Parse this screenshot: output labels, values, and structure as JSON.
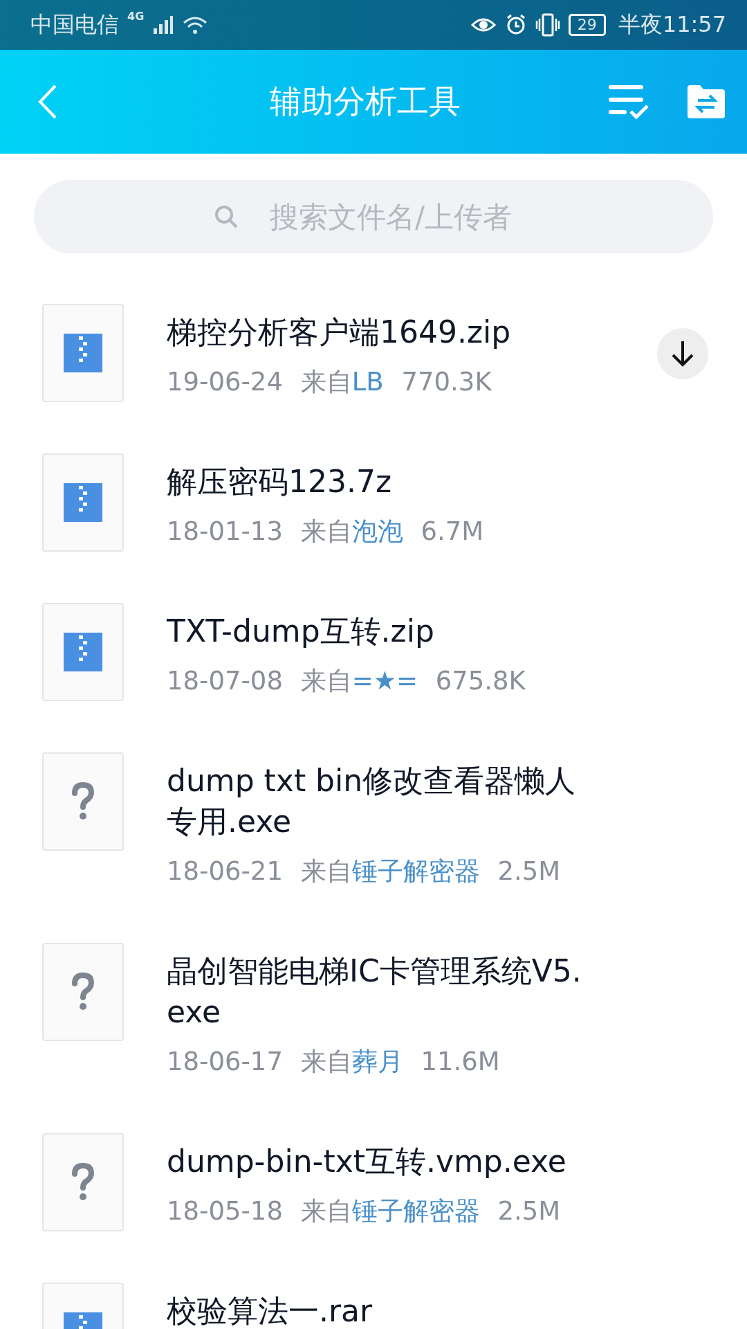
{
  "status_bar": {
    "carrier": "中国电信",
    "network": "4G",
    "battery": "29",
    "time": "半夜11:57"
  },
  "header": {
    "title": "辅助分析工具"
  },
  "search": {
    "placeholder": "搜索文件名/上传者"
  },
  "files": [
    {
      "name": "梯控分析客户端1649.zip",
      "kind": "archive",
      "date": "19-06-24",
      "from_label": "来自",
      "uploader": "LB",
      "size": "770.3K",
      "download": true
    },
    {
      "name": "解压密码123.7z",
      "kind": "archive",
      "date": "18-01-13",
      "from_label": "来自",
      "uploader": "泡泡",
      "size": "6.7M",
      "download": false
    },
    {
      "name": "TXT-dump互转.zip",
      "kind": "archive",
      "date": "18-07-08",
      "from_label": "来自",
      "uploader": "=★=",
      "size": "675.8K",
      "download": false
    },
    {
      "name": "dump txt bin修改查看器懒人专用.exe",
      "kind": "unknown",
      "date": "18-06-21",
      "from_label": "来自",
      "uploader": "锤子解密器",
      "size": "2.5M",
      "download": false
    },
    {
      "name": "晶创智能电梯IC卡管理系统V5.exe",
      "kind": "unknown",
      "date": "18-06-17",
      "from_label": "来自",
      "uploader": "葬月",
      "size": "11.6M",
      "download": false
    },
    {
      "name": "dump-bin-txt互转.vmp.exe",
      "kind": "unknown",
      "date": "18-05-18",
      "from_label": "来自",
      "uploader": "锤子解密器",
      "size": "2.5M",
      "download": false
    },
    {
      "name": "校验算法一.rar",
      "kind": "archive",
      "download": false
    }
  ]
}
